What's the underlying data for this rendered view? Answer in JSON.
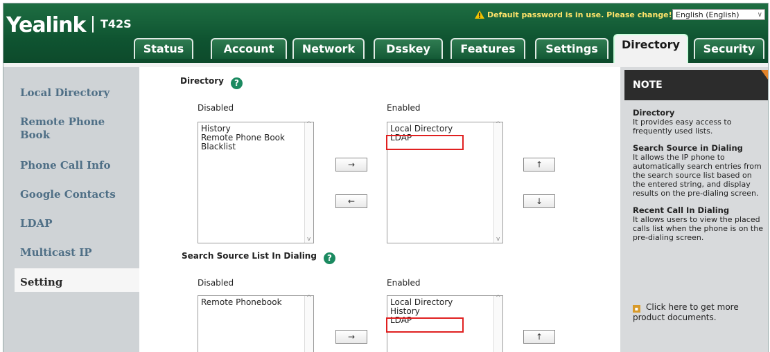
{
  "header": {
    "logo": "Yealink",
    "model": "T42S",
    "warning": "Default password is in use. Please change!",
    "language": "English (English)"
  },
  "tabs": [
    {
      "label": "Status"
    },
    {
      "label": "Account"
    },
    {
      "label": "Network"
    },
    {
      "label": "Dsskey"
    },
    {
      "label": "Features"
    },
    {
      "label": "Settings"
    },
    {
      "label": "Directory",
      "active": true
    },
    {
      "label": "Security"
    }
  ],
  "sidebar": {
    "items": [
      {
        "label": "Local Directory"
      },
      {
        "label": "Remote Phone Book"
      },
      {
        "label": "Phone Call Info"
      },
      {
        "label": "Google Contacts"
      },
      {
        "label": "LDAP"
      },
      {
        "label": "Multicast IP"
      },
      {
        "label": "Setting",
        "active": true
      }
    ]
  },
  "directory": {
    "title": "Directory",
    "disabled_label": "Disabled",
    "enabled_label": "Enabled",
    "disabled": [
      "History",
      "Remote Phone Book",
      "Blacklist"
    ],
    "enabled": [
      "Local Directory",
      "LDAP"
    ],
    "move_right": "→",
    "move_left": "←",
    "move_up": "↑",
    "move_down": "↓"
  },
  "search": {
    "title": "Search Source List In Dialing",
    "disabled_label": "Disabled",
    "enabled_label": "Enabled",
    "disabled": [
      "Remote Phonebook"
    ],
    "enabled": [
      "Local Directory",
      "History",
      "LDAP"
    ],
    "move_right": "→",
    "move_up": "↑"
  },
  "note": {
    "title": "NOTE",
    "sections": [
      {
        "heading": "Directory",
        "text": "It provides easy access to frequently used lists."
      },
      {
        "heading": "Search Source in Dialing",
        "text": "It allows the IP phone to automatically search entries from the search source list based on the entered string, and display results on the pre-dialing screen."
      },
      {
        "heading": "Recent Call In Dialing",
        "text": "It allows users to view the placed calls list when the phone is on the pre-dialing screen."
      }
    ],
    "link": "Click here to get more product documents."
  },
  "colors": {
    "header_green": "#0f5431",
    "nav_text": "#4f6f86",
    "highlight_red": "#e02020",
    "help_green": "#1b8a60"
  }
}
